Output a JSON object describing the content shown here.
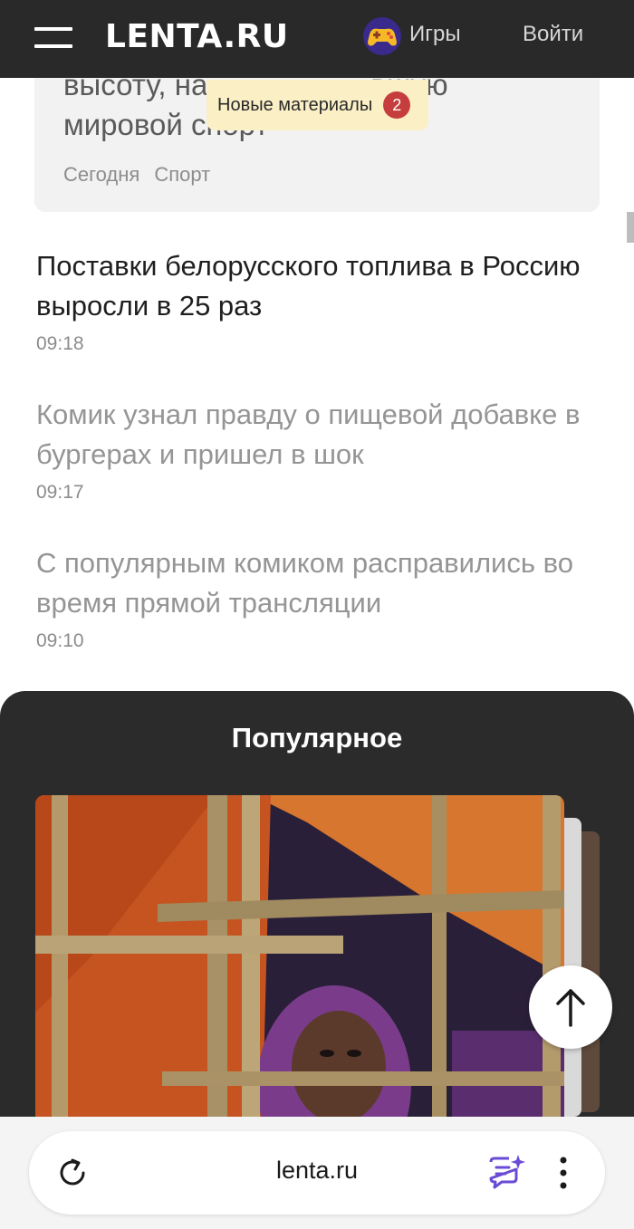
{
  "header": {
    "logo": "LENTA.RU",
    "games_label": "Игры",
    "login_label": "Войти"
  },
  "top_card": {
    "title_line1": "высоту, на",
    "title_line1_end": "вшую",
    "title_line2": "мировой спорт",
    "date": "Сегодня",
    "category": "Спорт"
  },
  "new_materials": {
    "label": "Новые материалы",
    "count": "2"
  },
  "news": [
    {
      "title": "Поставки белорусского топлива в Россию выросли в 25 раз",
      "time": "09:18",
      "read": false
    },
    {
      "title": "Комик узнал правду о пищевой добавке в бургерах и пришел в шок",
      "time": "09:17",
      "read": true
    },
    {
      "title": "С популярным комиком расправились во время прямой трансляции",
      "time": "09:10",
      "read": true
    }
  ],
  "popular": {
    "title": "Популярное"
  },
  "browser": {
    "url": "lenta.ru"
  },
  "colors": {
    "header_bg": "#292929",
    "popular_bg": "#2b2b2b",
    "badge_red": "#c63d3d",
    "pill_yellow": "#fbefc6",
    "ai_purple": "#6a4bd6"
  },
  "icons": {
    "menu": "burger-menu-icon",
    "games": "gamepad-icon",
    "scroll_top": "arrow-up-icon",
    "reload": "reload-icon",
    "ai_chat": "ai-chat-icon",
    "more": "more-vertical-icon"
  }
}
